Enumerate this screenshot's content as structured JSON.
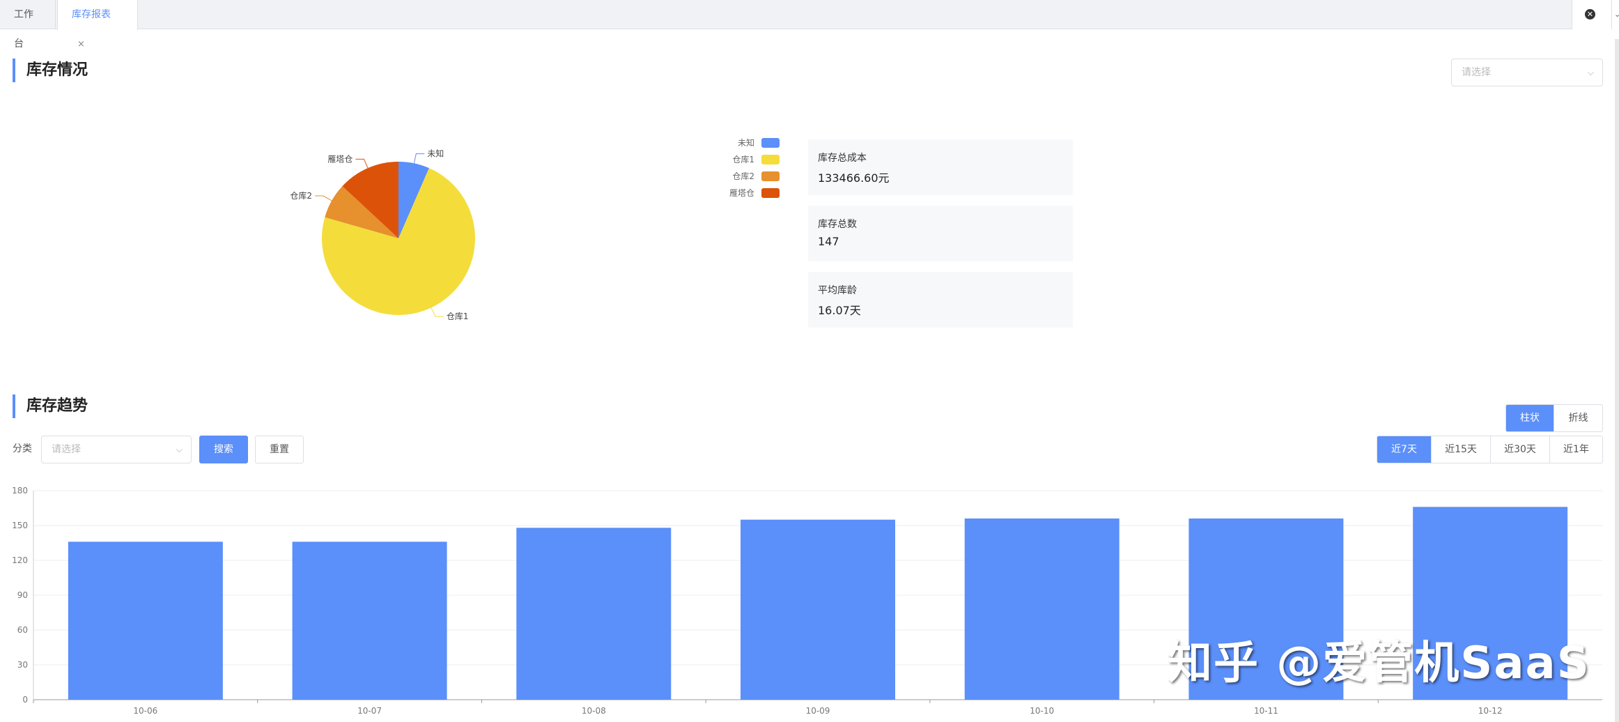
{
  "tabs": [
    {
      "label": "工作台",
      "active": false
    },
    {
      "label": "库存报表",
      "active": true,
      "close": "×"
    }
  ],
  "inventory": {
    "title": "库存情况",
    "select_placeholder": "请选择",
    "stats": [
      {
        "label": "库存总成本",
        "value": "133466.60元"
      },
      {
        "label": "库存总数",
        "value": "147"
      },
      {
        "label": "平均库龄",
        "value": "16.07天"
      }
    ]
  },
  "trend": {
    "title": "库存趋势",
    "filter_label": "分类",
    "filter_placeholder": "请选择",
    "search_label": "搜索",
    "reset_label": "重置",
    "chart_types": [
      {
        "label": "柱状",
        "active": true
      },
      {
        "label": "折线",
        "active": false
      }
    ],
    "ranges": [
      {
        "label": "近7天",
        "active": true
      },
      {
        "label": "近15天",
        "active": false
      },
      {
        "label": "近30天",
        "active": false
      },
      {
        "label": "近1年",
        "active": false
      }
    ]
  },
  "chart_data": [
    {
      "type": "pie",
      "slices": [
        {
          "label": "未知",
          "value": 7,
          "color": "#5b8ff9"
        },
        {
          "label": "仓库1",
          "value": 78,
          "color": "#f4dd3b"
        },
        {
          "label": "仓库2",
          "value": 8,
          "color": "#e6902e"
        },
        {
          "label": "雁塔仓",
          "value": 14,
          "color": "#dd5209"
        }
      ],
      "legend": [
        "未知",
        "仓库1",
        "仓库2",
        "雁塔仓"
      ],
      "legend_position": "right"
    },
    {
      "type": "bar",
      "categories": [
        "10-06",
        "10-07",
        "10-08",
        "10-09",
        "10-10",
        "10-11",
        "10-12"
      ],
      "values": [
        136,
        136,
        148,
        155,
        156,
        156,
        166
      ],
      "yticks": [
        0,
        30,
        60,
        90,
        120,
        150,
        180
      ],
      "ylim": [
        0,
        180
      ],
      "grid": true,
      "color": "#5b8ff9"
    }
  ],
  "watermark": "知乎 @爱管机SaaS"
}
